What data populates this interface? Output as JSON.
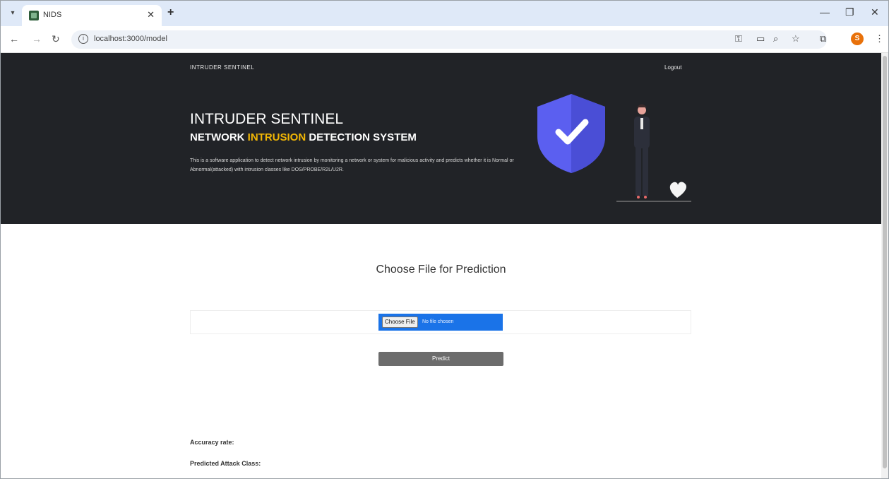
{
  "browser": {
    "tab_title": "NIDS",
    "url": "localhost:3000/model",
    "profile_initial": "S"
  },
  "header": {
    "brand": "INTRUDER SENTINEL",
    "logout": "Logout"
  },
  "hero": {
    "title": "INTRUDER SENTINEL",
    "subtitle_before": "NETWORK ",
    "subtitle_accent": "INTRUSION",
    "subtitle_after": " DETECTION SYSTEM",
    "description": "This is a software application to detect network intrusion by monitoring a network or system for malicious activity and predicts whether it is Normal or Abnormal(attacked) with intrusion classes like DOS/PROBE/R2L/U2R.",
    "accent_color": "#f2b705",
    "background_color": "#212327"
  },
  "main": {
    "title": "Choose File for Prediction",
    "file_button": "Choose File",
    "file_status": "No file chosen",
    "predict_button": "Predict"
  },
  "results": {
    "accuracy_label": "Accuracy rate:",
    "attack_label": "Predicted Attack Class:"
  },
  "icons": [
    "menu-icon",
    "back-arrow-icon",
    "forward-arrow-icon",
    "reload-icon",
    "info-icon",
    "key-icon",
    "cast-icon",
    "zoom-icon",
    "star-icon",
    "extensions-icon",
    "more-icon",
    "shield-check-icon"
  ]
}
